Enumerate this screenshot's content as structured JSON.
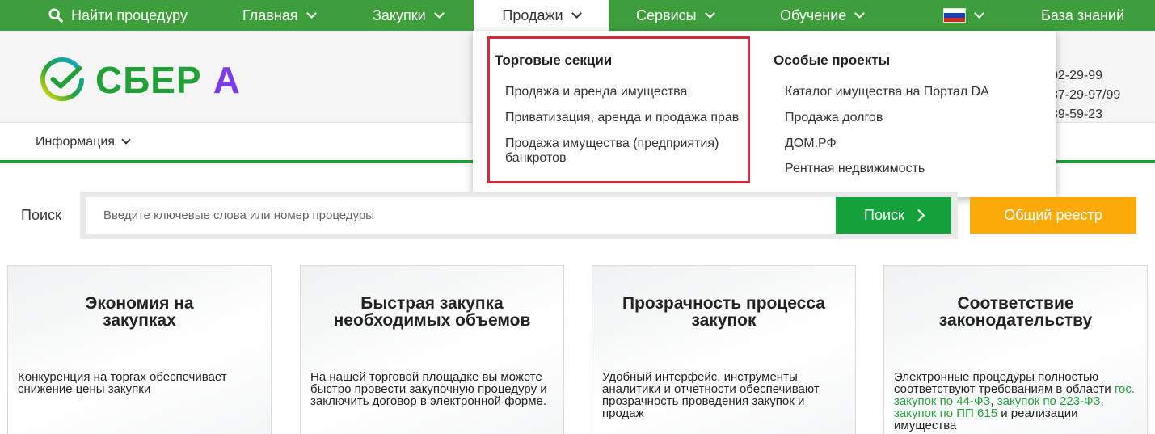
{
  "topnav": {
    "find_label": "Найти процедуру",
    "main": "Главная",
    "purchases": "Закупки",
    "sales": "Продажи",
    "services": "Сервисы",
    "training": "Обучение",
    "knowledge": "База знаний"
  },
  "header": {
    "logo_text": "СБЕР",
    "logo_suffix": "А",
    "phones": [
      "02-29-99",
      "37-29-97/99",
      "39-59-23"
    ]
  },
  "infobar": {
    "info_label": "Информация"
  },
  "dropdown": {
    "left_title": "Торговые секции",
    "left_items": [
      "Продажа и аренда имущества",
      "Приватизация, аренда и продажа прав",
      "Продажа имущества (предприятия) банкротов"
    ],
    "right_title": "Особые проекты",
    "right_items": [
      "Каталог имущества на Портал DA",
      "Продажа долгов",
      "ДОМ.РФ",
      "Рентная недвижимость"
    ]
  },
  "search": {
    "label": "Поиск",
    "placeholder": "Введите ключевые слова или номер процедуры",
    "button": "Поиск",
    "registry": "Общий реестр"
  },
  "cards": [
    {
      "title": "Экономия на закупках",
      "text": "Конкуренция на торгах обеспечивает снижение цены закупки"
    },
    {
      "title": "Быстрая закупка необходимых объемов",
      "text": "На нашей торговой площадке вы можете быстро провести закупочную процедуру и заключить договор в электронной форме."
    },
    {
      "title": "Прозрачность процесса закупок",
      "text": "Удобный интерфейс, инструменты аналитики и отчетности обеспечивают прозрачность проведения закупок и продаж"
    },
    {
      "title": "Соответствие законодательству",
      "text_pre": "Электронные процедуры полностью соответствуют требованиям в области",
      "link1": "гос. закупок по 44-ФЗ",
      "sep1": ",",
      "link2": "закупок по 223-ФЗ",
      "sep2": ",",
      "link3": "закупок по ПП 615",
      "text_post": "и реализации имущества"
    }
  ],
  "colors": {
    "nav_green": "#3d9e3b",
    "brand_green": "#21a038",
    "search_button": "#13a23c",
    "registry_orange": "#fbaa08",
    "highlight_red": "#d42a3a"
  }
}
